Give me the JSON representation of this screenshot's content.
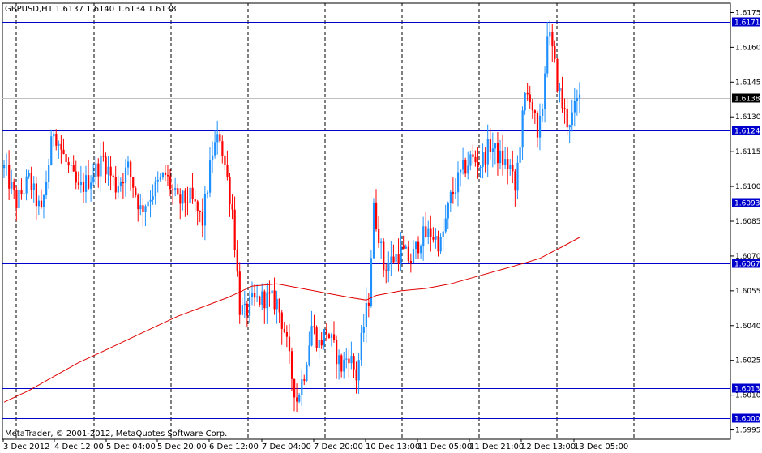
{
  "header": {
    "symbol_timeframe": "GBPUSD,H1",
    "ohlc": "1.6137 1.6140 1.6134 1.6138"
  },
  "footer": {
    "copyright": "MetaTrader, © 2001-2012, MetaQuotes Software Corp."
  },
  "colors": {
    "bull": "#1e90ff",
    "bear": "#ff0000",
    "ma": "#e00000",
    "hline": "#0000cc",
    "tag_bg": "#0000cc",
    "current_tag_bg": "#000000",
    "grid": "#000000"
  },
  "chart_data": {
    "type": "candlestick",
    "symbol": "GBPUSD",
    "timeframe": "H1",
    "ylim": [
      1.5991,
      1.6179
    ],
    "y_ticks": [
      "1.6175",
      "1.6160",
      "1.6145",
      "1.6130",
      "1.6115",
      "1.6100",
      "1.6085",
      "1.6070",
      "1.6055",
      "1.6040",
      "1.6025",
      "1.6010",
      "1.5995"
    ],
    "x_ticks": [
      "3 Dec 2012",
      "4 Dec 12:00",
      "5 Dec 04:00",
      "5 Dec 20:00",
      "6 Dec 12:00",
      "7 Dec 04:00",
      "7 Dec 20:00",
      "10 Dec 13:00",
      "11 Dec 05:00",
      "11 Dec 21:00",
      "12 Dec 13:00",
      "13 Dec 05:00"
    ],
    "horizontal_lines": [
      {
        "label": "1.6171",
        "value": 1.6171
      },
      {
        "label": "1.6124",
        "value": 1.6124
      },
      {
        "label": "1.6093",
        "value": 1.6093
      },
      {
        "label": "1.6067",
        "value": 1.6067
      },
      {
        "label": "1.6013",
        "value": 1.6013
      },
      {
        "label": "1.6000",
        "value": 1.6
      }
    ],
    "current_price": {
      "label": "1.6138",
      "value": 1.6138
    },
    "moving_average": [
      [
        0,
        1.6007
      ],
      [
        10,
        1.6012
      ],
      [
        20,
        1.6018
      ],
      [
        30,
        1.6024
      ],
      [
        40,
        1.6029
      ],
      [
        50,
        1.6034
      ],
      [
        60,
        1.6039
      ],
      [
        70,
        1.6044
      ],
      [
        80,
        1.6048
      ],
      [
        90,
        1.6052
      ],
      [
        96,
        1.6055
      ],
      [
        100,
        1.6057
      ],
      [
        110,
        1.6058
      ],
      [
        120,
        1.6056
      ],
      [
        130,
        1.6054
      ],
      [
        140,
        1.6052
      ],
      [
        146,
        1.6051
      ],
      [
        150,
        1.6053
      ],
      [
        160,
        1.6055
      ],
      [
        170,
        1.6056
      ],
      [
        180,
        1.6058
      ],
      [
        190,
        1.6061
      ],
      [
        200,
        1.6064
      ],
      [
        210,
        1.6067
      ],
      [
        216,
        1.6069
      ],
      [
        225,
        1.6074
      ],
      [
        232,
        1.6078
      ]
    ],
    "price_path": [
      [
        0,
        1.6108
      ],
      [
        5,
        1.6093
      ],
      [
        10,
        1.6103
      ],
      [
        15,
        1.6088
      ],
      [
        20,
        1.6125
      ],
      [
        25,
        1.611
      ],
      [
        30,
        1.6098
      ],
      [
        35,
        1.6104
      ],
      [
        40,
        1.6112
      ],
      [
        45,
        1.61
      ],
      [
        50,
        1.6108
      ],
      [
        55,
        1.609
      ],
      [
        60,
        1.6098
      ],
      [
        65,
        1.6105
      ],
      [
        70,
        1.6093
      ],
      [
        75,
        1.6095
      ],
      [
        80,
        1.6085
      ],
      [
        84,
        1.6115
      ],
      [
        87,
        1.6122
      ],
      [
        92,
        1.609
      ],
      [
        95,
        1.6048
      ],
      [
        97,
        1.6045
      ],
      [
        100,
        1.605
      ],
      [
        105,
        1.6052
      ],
      [
        110,
        1.605
      ],
      [
        113,
        1.6038
      ],
      [
        116,
        1.6018
      ],
      [
        118,
        1.6008
      ],
      [
        121,
        1.602
      ],
      [
        124,
        1.604
      ],
      [
        127,
        1.6032
      ],
      [
        130,
        1.6038
      ],
      [
        133,
        1.603
      ],
      [
        136,
        1.6022
      ],
      [
        139,
        1.6028
      ],
      [
        142,
        1.6018
      ],
      [
        145,
        1.604
      ],
      [
        147,
        1.6052
      ],
      [
        149,
        1.609
      ],
      [
        151,
        1.608
      ],
      [
        153,
        1.6065
      ],
      [
        156,
        1.6068
      ],
      [
        160,
        1.6072
      ],
      [
        164,
        1.6068
      ],
      [
        168,
        1.6078
      ],
      [
        172,
        1.608
      ],
      [
        176,
        1.6075
      ],
      [
        180,
        1.6095
      ],
      [
        184,
        1.6105
      ],
      [
        188,
        1.6112
      ],
      [
        192,
        1.611
      ],
      [
        196,
        1.6118
      ],
      [
        200,
        1.6112
      ],
      [
        204,
        1.6108
      ],
      [
        206,
        1.6098
      ],
      [
        208,
        1.612
      ],
      [
        210,
        1.6138
      ],
      [
        212,
        1.614
      ],
      [
        214,
        1.6128
      ],
      [
        215,
        1.6118
      ],
      [
        217,
        1.6135
      ],
      [
        218,
        1.615
      ],
      [
        219,
        1.6168
      ],
      [
        221,
        1.6158
      ],
      [
        223,
        1.6145
      ],
      [
        225,
        1.6135
      ],
      [
        227,
        1.6128
      ],
      [
        229,
        1.613
      ],
      [
        231,
        1.6136
      ],
      [
        232,
        1.6138
      ]
    ]
  }
}
